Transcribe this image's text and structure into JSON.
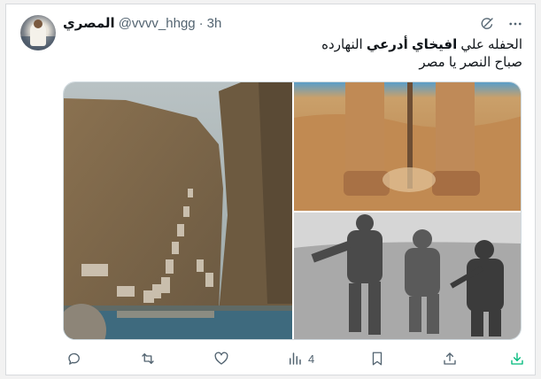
{
  "tweet": {
    "display_name": "المصري",
    "handle": "@vvvv_hhgg",
    "separator": "·",
    "time": "3h",
    "text_line1_prefix": "الحفله علي",
    "text_line1_bold": "افيخاي أدرعي",
    "text_line1_suffix": "النهارده",
    "text_line2": "صباح النصر يا مصر"
  },
  "top_icons": [
    "grok-icon",
    "more-icon"
  ],
  "actions": {
    "reply": {
      "icon": "reply-icon",
      "count": ""
    },
    "retweet": {
      "icon": "retweet-icon",
      "count": ""
    },
    "like": {
      "icon": "heart-icon",
      "count": ""
    },
    "views": {
      "icon": "views-icon",
      "count": "4"
    },
    "bookmark": {
      "icon": "bookmark-icon",
      "count": ""
    },
    "share": {
      "icon": "share-icon",
      "count": ""
    },
    "download": {
      "icon": "download-icon",
      "count": ""
    }
  },
  "colors": {
    "text": "#0f1419",
    "muted": "#536471",
    "accent_download": "#00ba7c",
    "border": "#cfd9de"
  }
}
